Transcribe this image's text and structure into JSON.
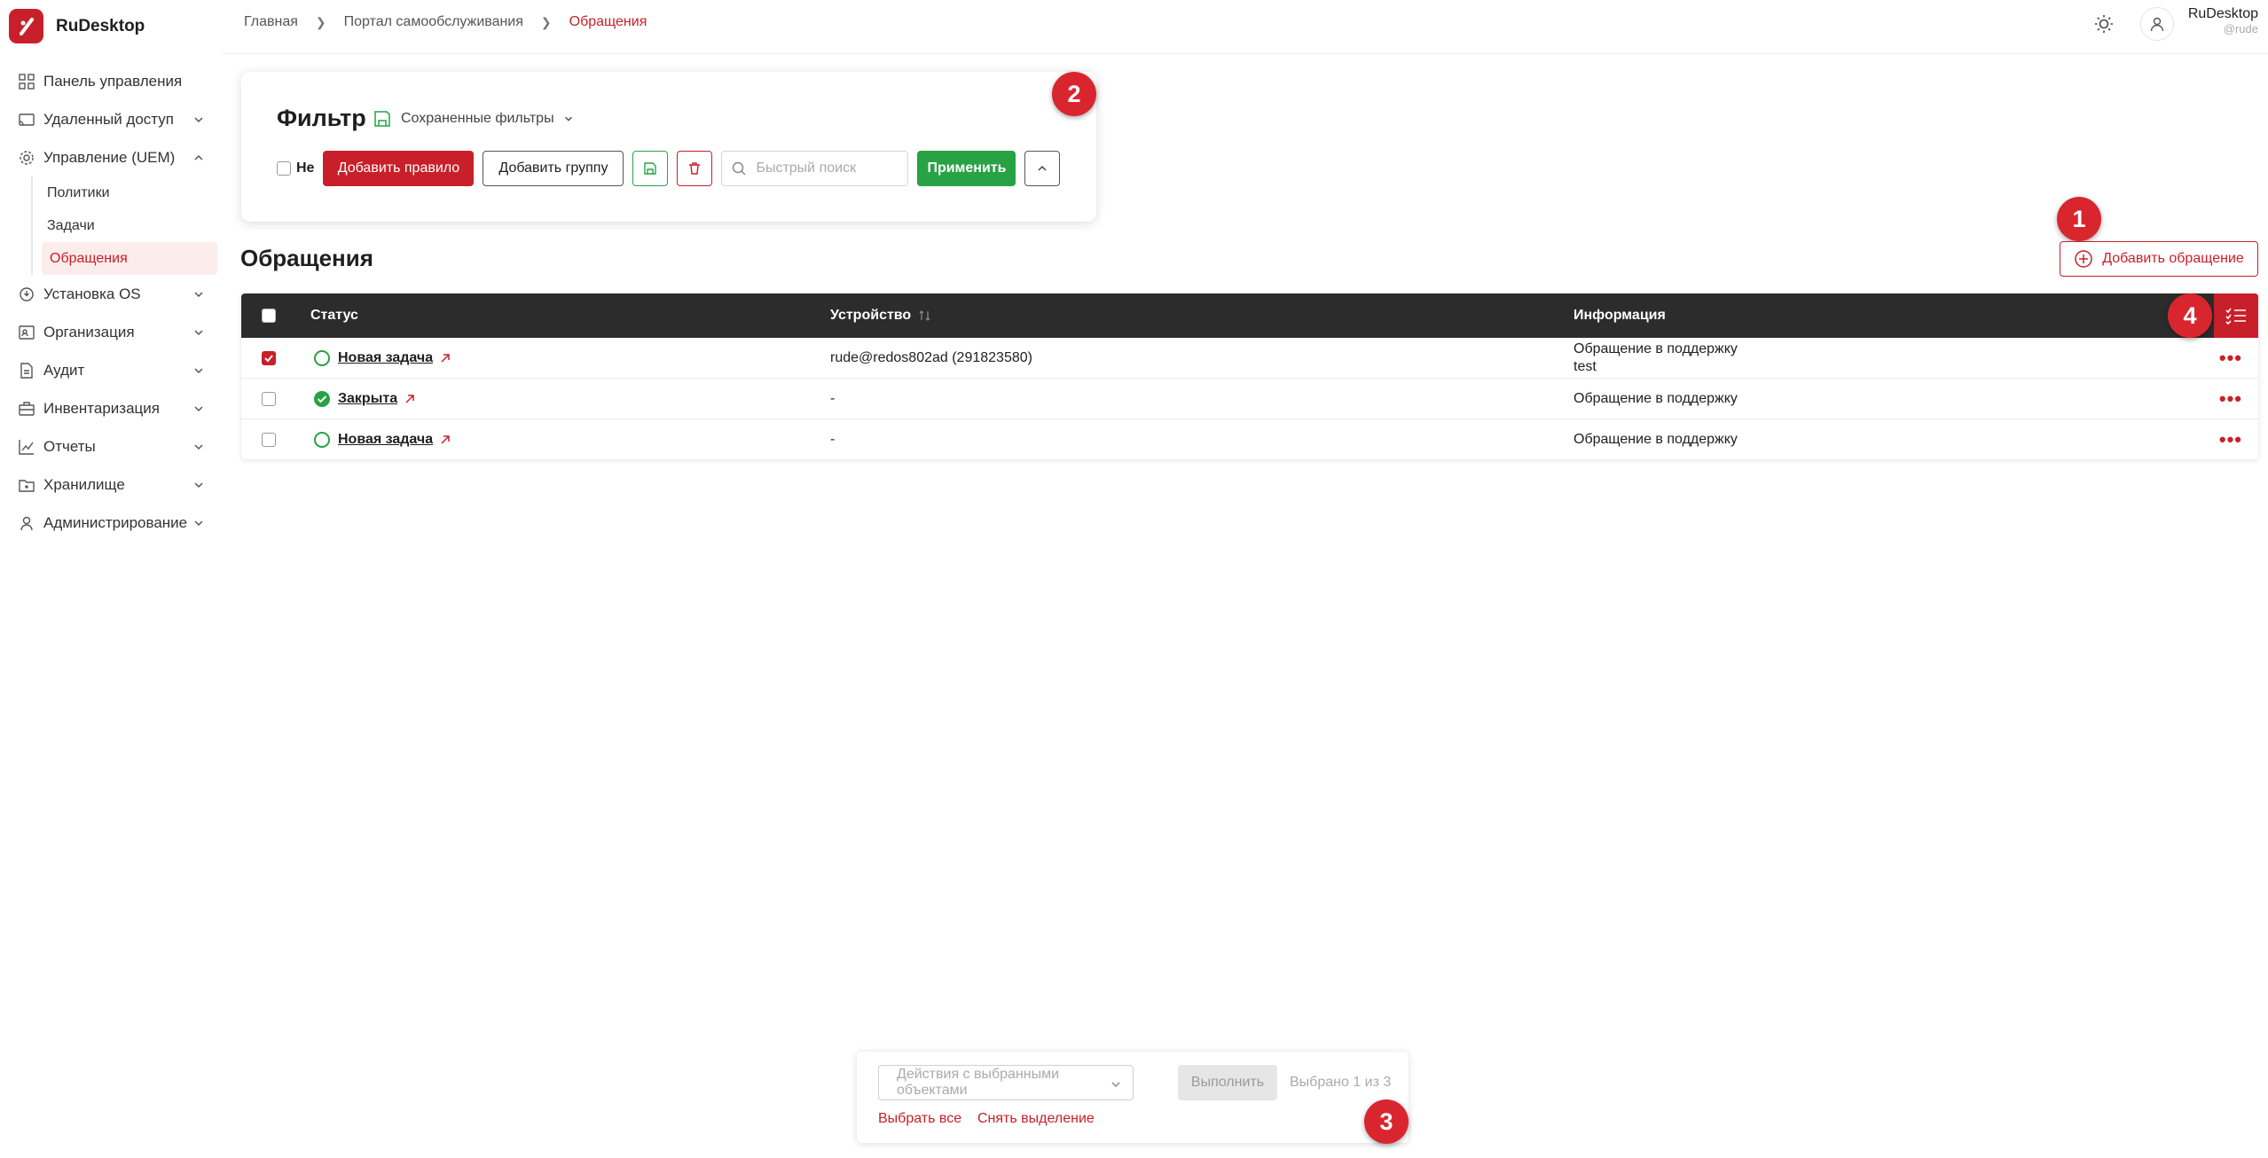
{
  "app": {
    "name": "RuDesktop",
    "brand_color": "#c8202a"
  },
  "breadcrumb": [
    "Главная",
    "Портал самообслуживания",
    "Обращения"
  ],
  "user": {
    "name": "RuDesktop",
    "handle": "@rude"
  },
  "sidebar": {
    "items": [
      {
        "label": "Панель управления",
        "icon": "dashboard-icon"
      },
      {
        "label": "Удаленный доступ",
        "icon": "remote-access-icon"
      },
      {
        "label": "Управление (UEM)",
        "icon": "gear-icon",
        "expanded": true,
        "children": [
          "Политики",
          "Задачи",
          "Обращения"
        ],
        "active_child": "Обращения"
      },
      {
        "label": "Установка OS",
        "icon": "os-install-icon"
      },
      {
        "label": "Организация",
        "icon": "organization-icon"
      },
      {
        "label": "Аудит",
        "icon": "audit-icon"
      },
      {
        "label": "Инвентаризация",
        "icon": "inventory-icon"
      },
      {
        "label": "Отчеты",
        "icon": "reports-icon"
      },
      {
        "label": "Хранилище",
        "icon": "storage-icon"
      },
      {
        "label": "Администрирование",
        "icon": "admin-icon"
      }
    ]
  },
  "filter": {
    "title": "Фильтр",
    "saved_filters": "Сохраненные фильтры",
    "not_label": "Не",
    "add_rule": "Добавить правило",
    "add_group": "Добавить группу",
    "search_placeholder": "Быстрый поиск",
    "apply": "Применить"
  },
  "markers": [
    "1",
    "2",
    "3",
    "4"
  ],
  "page": {
    "title": "Обращения",
    "add_button": "Добавить обращение"
  },
  "table": {
    "columns": [
      "Статус",
      "Устройство",
      "Информация"
    ],
    "rows": [
      {
        "checked": true,
        "status": "Новая задача",
        "status_type": "new",
        "device": "rude@redos802ad (291823580)",
        "info": [
          "Обращение в поддержку",
          "test"
        ]
      },
      {
        "checked": false,
        "status": "Закрыта",
        "status_type": "closed",
        "device": "-",
        "info": [
          "Обращение в поддержку"
        ]
      },
      {
        "checked": false,
        "status": "Новая задача",
        "status_type": "new",
        "device": "-",
        "info": [
          "Обращение в поддержку"
        ]
      }
    ],
    "more": "•••"
  },
  "bulk": {
    "actions_placeholder": "Действия с выбранными объектами",
    "execute": "Выполнить",
    "selected": "Выбрано 1 из 3",
    "select_all": "Выбрать все",
    "clear_selection": "Снять выделение"
  }
}
